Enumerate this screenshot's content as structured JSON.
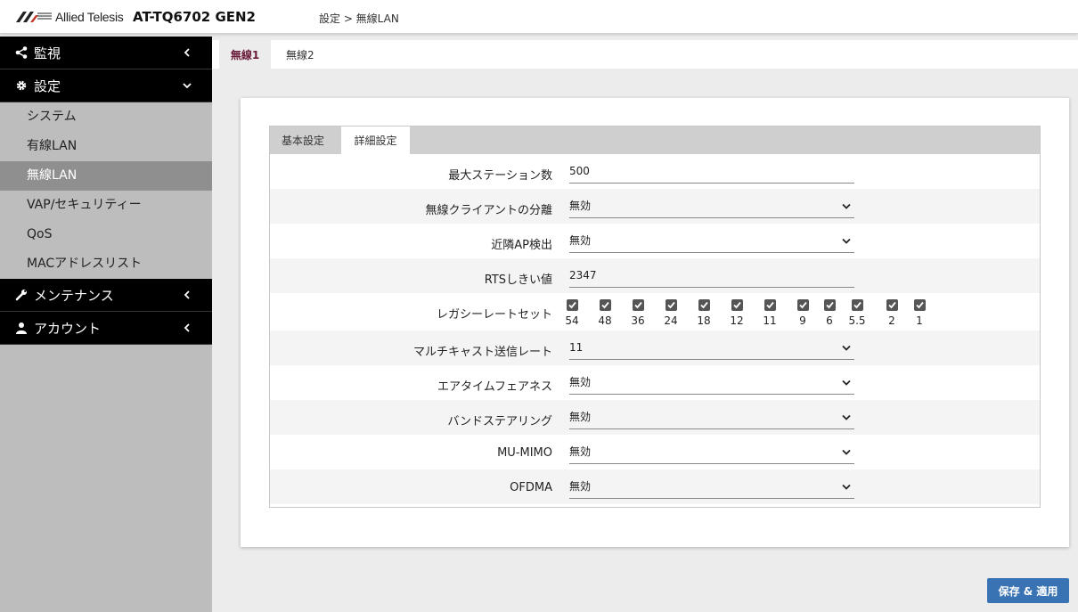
{
  "header": {
    "brand": "Allied Telesis",
    "model": "AT-TQ6702 GEN2",
    "breadcrumb": "設定 > 無線LAN"
  },
  "sidebar": {
    "groups": {
      "monitor": {
        "label": "監視",
        "icon": "share-icon"
      },
      "settings": {
        "label": "設定",
        "icon": "gear-icon"
      },
      "maintenance": {
        "label": "メンテナンス",
        "icon": "wrench-icon"
      },
      "account": {
        "label": "アカウント",
        "icon": "user-icon"
      }
    },
    "items": [
      {
        "label": "システム"
      },
      {
        "label": "有線LAN"
      },
      {
        "label": "無線LAN",
        "active": true
      },
      {
        "label": "VAP/セキュリティー"
      },
      {
        "label": "QoS"
      },
      {
        "label": "MACアドレスリスト"
      }
    ]
  },
  "radio_tabs": [
    "無線1",
    "無線2"
  ],
  "sub_tabs": [
    "基本設定",
    "詳細設定"
  ],
  "form": {
    "max_stations": {
      "label": "最大ステーション数",
      "value": "500"
    },
    "client_isolation": {
      "label": "無線クライアントの分離",
      "value": "無効"
    },
    "neighbor_ap": {
      "label": "近隣AP検出",
      "value": "無効"
    },
    "rts_threshold": {
      "label": "RTSしきい値",
      "value": "2347"
    },
    "legacy_rates": {
      "label": "レガシーレートセット",
      "rates": [
        "54",
        "48",
        "36",
        "24",
        "18",
        "12",
        "11",
        "9",
        "6",
        "5.5",
        "2",
        "1"
      ]
    },
    "multicast_rate": {
      "label": "マルチキャスト送信レート",
      "value": "11"
    },
    "airtime_fairness": {
      "label": "エアタイムフェアネス",
      "value": "無効"
    },
    "band_steering": {
      "label": "バンドステアリング",
      "value": "無効"
    },
    "mu_mimo": {
      "label": "MU-MIMO",
      "value": "無効"
    },
    "ofdma": {
      "label": "OFDMA",
      "value": "無効"
    }
  },
  "save_button": "保存 & 適用",
  "colors": {
    "accent": "#3a73b3",
    "active_tab": "#6a1b3a",
    "sidebar_active": "#8f8f8f"
  }
}
